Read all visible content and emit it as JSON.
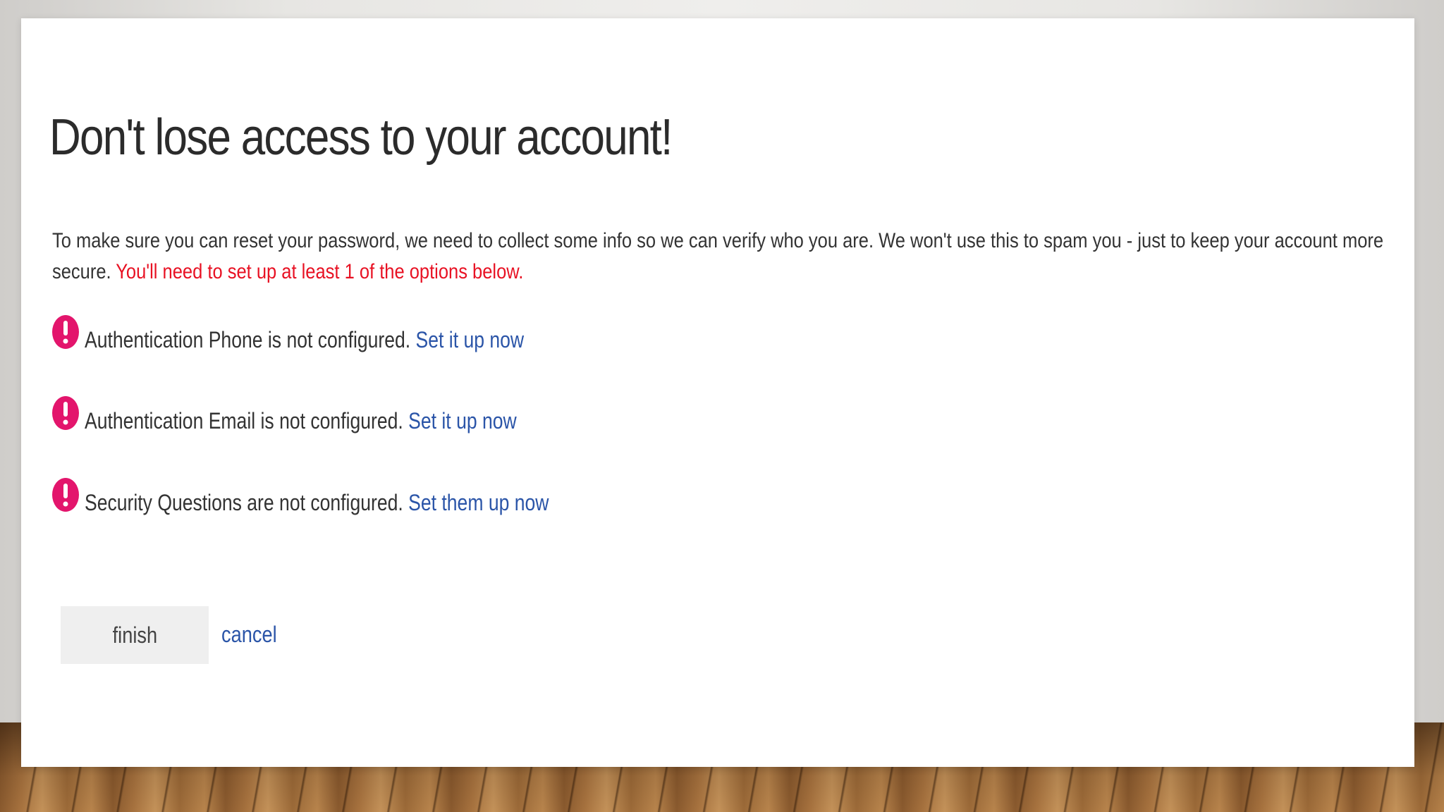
{
  "page": {
    "title": "Don't lose access to your account!",
    "intro_text": "To make sure you can reset your password, we need to collect some info so we can verify who you are. We won't use this to spam you - just to keep your account more secure. ",
    "intro_warning": "You'll need to set up at least 1 of the options below."
  },
  "items": [
    {
      "icon": "alert-icon",
      "text": "Authentication Phone is not configured. ",
      "link": "Set it up now"
    },
    {
      "icon": "alert-icon",
      "text": "Authentication Email is not configured. ",
      "link": "Set it up now"
    },
    {
      "icon": "alert-icon",
      "text": "Security Questions are not configured. ",
      "link": "Set them up now"
    }
  ],
  "actions": {
    "finish_label": "finish",
    "cancel_label": "cancel"
  },
  "colors": {
    "warning": "#e81123",
    "link": "#2b55a8",
    "alert_icon": "#e3156c"
  }
}
